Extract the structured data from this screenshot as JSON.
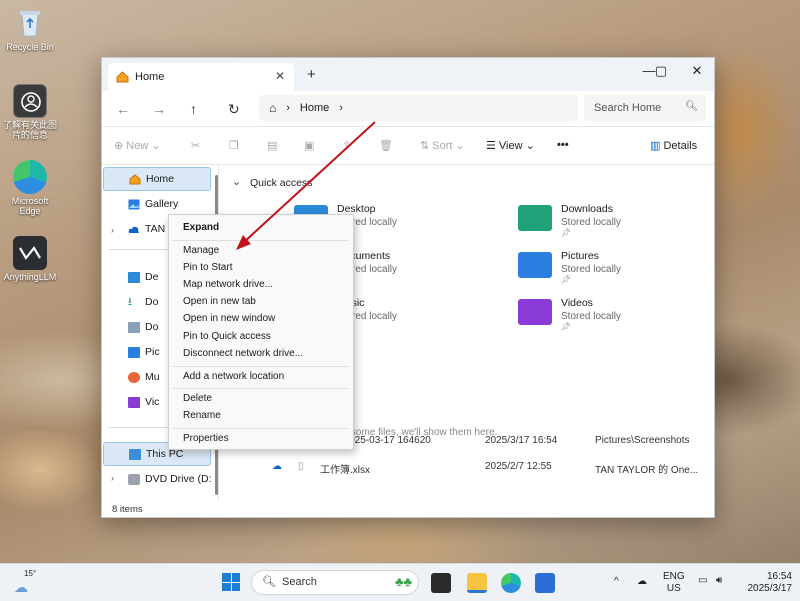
{
  "desktop": {
    "icons": [
      {
        "label": "Recycle Bin"
      },
      {
        "label": "了解有关此图片的信息"
      },
      {
        "label": "Microsoft Edge"
      },
      {
        "label": "AnythingLLM"
      }
    ]
  },
  "window": {
    "tab_title": "Home",
    "address": "Home",
    "search_placeholder": "Search Home",
    "toolbar": {
      "new": "New",
      "sort": "Sort",
      "view": "View",
      "more": "•••",
      "details": "Details"
    },
    "sidebar": {
      "items": [
        {
          "label": "Home"
        },
        {
          "label": "Gallery"
        },
        {
          "label": "TAN"
        },
        {
          "label": "De"
        },
        {
          "label": "Do"
        },
        {
          "label": "Do"
        },
        {
          "label": "Pic"
        },
        {
          "label": "Mu"
        },
        {
          "label": "Vic"
        },
        {
          "label": "This PC"
        },
        {
          "label": "DVD Drive (D:) C"
        }
      ]
    },
    "quick_access": {
      "title": "Quick access",
      "folders": [
        {
          "name": "Desktop",
          "sub": "Stored locally"
        },
        {
          "name": "Downloads",
          "sub": "Stored locally"
        },
        {
          "name": "Documents",
          "sub": "Stored locally"
        },
        {
          "name": "Pictures",
          "sub": "Stored locally"
        },
        {
          "name": "Music",
          "sub": "Stored locally"
        },
        {
          "name": "Videos",
          "sub": "Stored locally"
        }
      ]
    },
    "empty_note": "dd some files, we'll show them here.",
    "recent": [
      {
        "name": "] 2025-03-17 164620",
        "date": "2025/3/17 16:54",
        "location": "Pictures\\Screenshots"
      },
      {
        "name": "工作簿.xlsx",
        "date": "2025/2/7 12:55",
        "location": "TAN TAYLOR 的 One..."
      }
    ],
    "status": "8 items"
  },
  "context_menu": {
    "items": [
      "Expand",
      "Manage",
      "Pin to Start",
      "Map network drive...",
      "Open in new tab",
      "Open in new window",
      "Pin to Quick access",
      "Disconnect network drive...",
      "Add a network location",
      "Delete",
      "Rename",
      "Properties"
    ]
  },
  "taskbar": {
    "weather": "15°",
    "search": "Search",
    "lang_1": "ENG",
    "lang_2": "US",
    "time": "16:54",
    "date": "2025/3/17"
  },
  "colors": {
    "accent": "#0067c0",
    "arrow": "#c0141b"
  }
}
